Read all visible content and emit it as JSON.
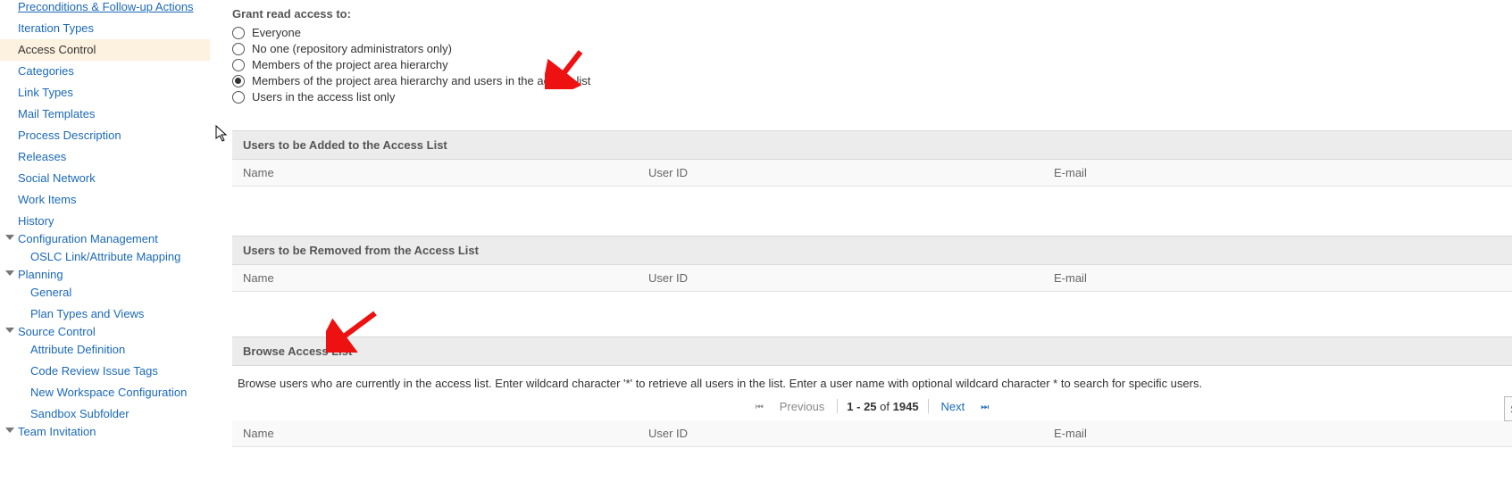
{
  "sidebar": {
    "items": [
      {
        "label": "Preconditions & Follow-up Actions",
        "kind": "item",
        "truncated": true
      },
      {
        "label": "Iteration Types",
        "kind": "item"
      },
      {
        "label": "Access Control",
        "kind": "item",
        "selected": true
      },
      {
        "label": "Categories",
        "kind": "item"
      },
      {
        "label": "Link Types",
        "kind": "item"
      },
      {
        "label": "Mail Templates",
        "kind": "item"
      },
      {
        "label": "Process Description",
        "kind": "item"
      },
      {
        "label": "Releases",
        "kind": "item"
      },
      {
        "label": "Social Network",
        "kind": "item"
      },
      {
        "label": "Work Items",
        "kind": "item"
      },
      {
        "label": "History",
        "kind": "item"
      },
      {
        "label": "Configuration Management",
        "kind": "group"
      },
      {
        "label": "OSLC Link/Attribute Mapping",
        "kind": "sub"
      },
      {
        "label": "Planning",
        "kind": "group"
      },
      {
        "label": "General",
        "kind": "sub"
      },
      {
        "label": "Plan Types and Views",
        "kind": "sub"
      },
      {
        "label": "Source Control",
        "kind": "group"
      },
      {
        "label": "Attribute Definition",
        "kind": "sub"
      },
      {
        "label": "Code Review Issue Tags",
        "kind": "sub"
      },
      {
        "label": "New Workspace Configuration",
        "kind": "sub"
      },
      {
        "label": "Sandbox Subfolder",
        "kind": "sub"
      },
      {
        "label": "Team Invitation",
        "kind": "group"
      }
    ]
  },
  "access": {
    "grant_label": "Grant read access to:",
    "options": [
      {
        "label": "Everyone",
        "checked": false
      },
      {
        "label": "No one (repository administrators only)",
        "checked": false
      },
      {
        "label": "Members of the project area hierarchy",
        "checked": false
      },
      {
        "label": "Members of the project area hierarchy and users in the access list",
        "checked": true
      },
      {
        "label": "Users in the access list only",
        "checked": false
      }
    ]
  },
  "columns": {
    "name": "Name",
    "userid": "User ID",
    "email": "E-mail"
  },
  "sections": {
    "to_add": "Users to be Added to the Access List",
    "to_remove": "Users to be Removed from the Access List",
    "browse": "Browse Access List",
    "browse_desc": "Browse users who are currently in the access list. Enter wildcard character '*' to retrieve all users in the list. Enter a user name with optional wildcard character * to search for specific users."
  },
  "pager": {
    "previous": "Previous",
    "next": "Next",
    "range_prefix": "1 - 25",
    "range_mid": " of ",
    "range_total": "1945"
  },
  "search": {
    "placeholder": "Search..."
  }
}
